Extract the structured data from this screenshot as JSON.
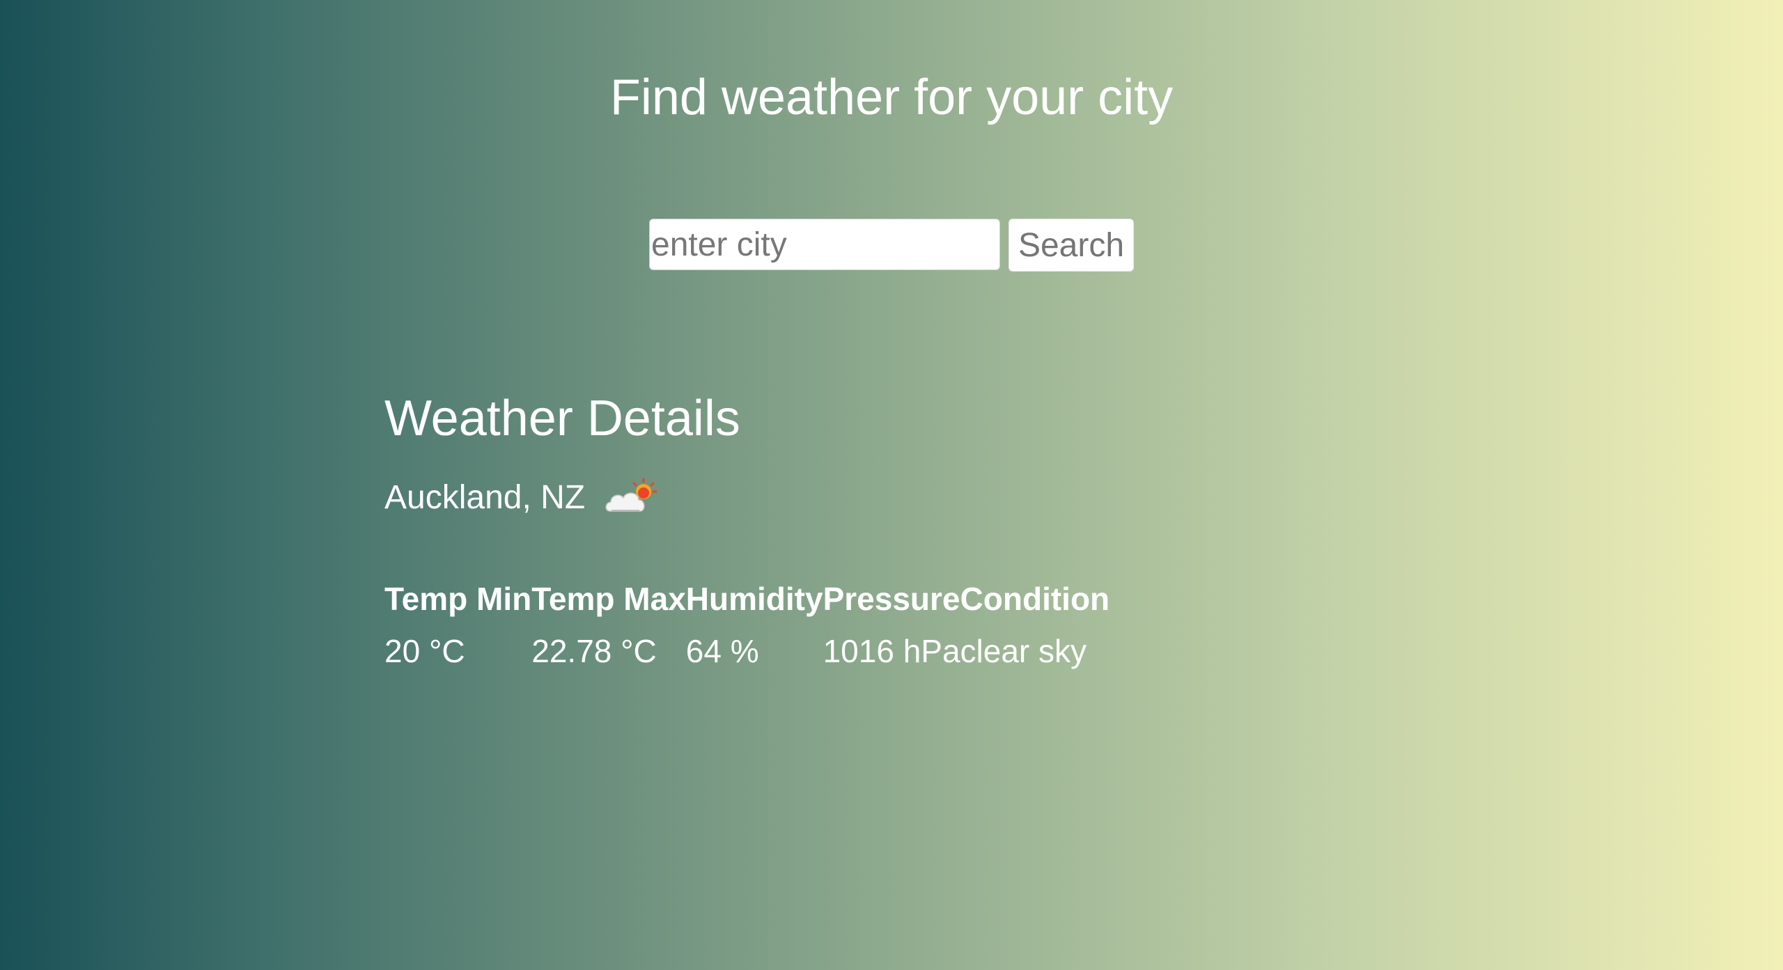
{
  "header": {
    "title": "Find weather for your city"
  },
  "search": {
    "placeholder": "enter city",
    "value": "",
    "button_label": "Search"
  },
  "details": {
    "title": "Weather Details",
    "location": "Auckland, NZ",
    "condition_icon": "cloud-sun-icon",
    "columns": [
      "Temp Min",
      "Temp Max",
      "Humidity",
      "Pressure",
      "Condition"
    ],
    "values": [
      "20 °C",
      "22.78 °C",
      "64 %",
      "1016 hPa",
      "clear sky"
    ]
  },
  "colors": {
    "gradient_start": "#1a5157",
    "gradient_end": "#f2f0b7",
    "text": "#ffffff"
  }
}
